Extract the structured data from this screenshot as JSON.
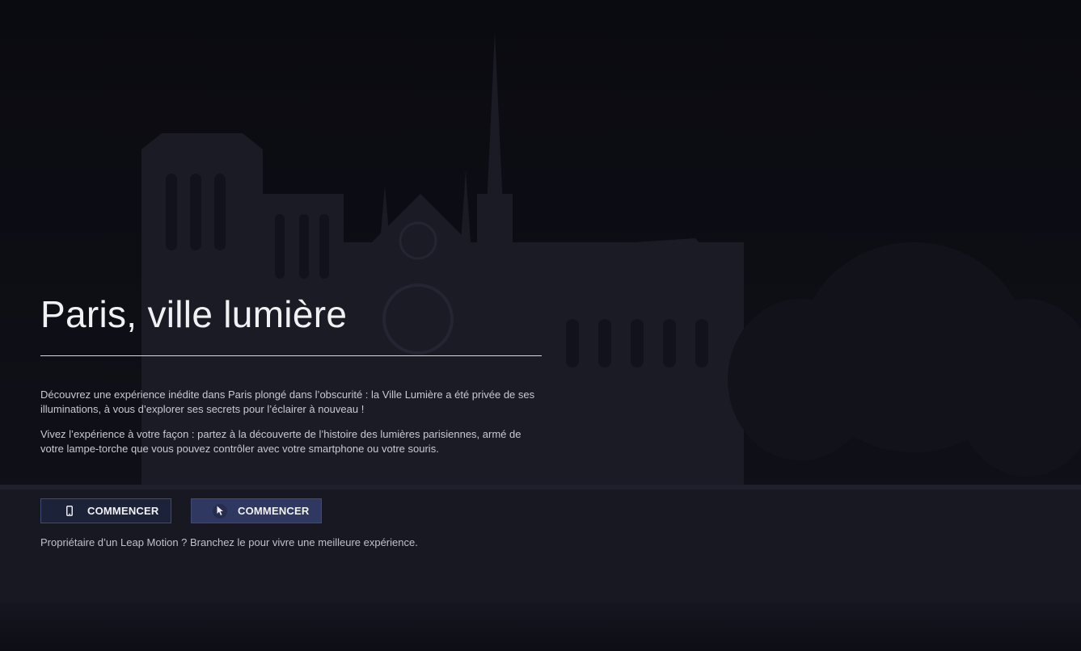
{
  "hero": {
    "title": "Paris, ville lumière",
    "paragraph_1": "Découvrez une expérience inédite dans Paris plongé dans l’obscurité : la Ville Lumière a été privée de ses illuminations, à vous d’explorer ses secrets pour l’éclairer à nouveau !",
    "paragraph_2": "Vivez l’expérience à votre façon : partez à la découverte de l’histoire des lumières parisiennes, armé de votre lampe-torche que vous pouvez contrôler avec votre smartphone ou votre souris.",
    "footnote": "Propriétaire d’un Leap Motion ? Branchez le pour vivre une meilleure expérience."
  },
  "buttons": {
    "smartphone": {
      "label": "COMMENCER",
      "icon": "smartphone-icon"
    },
    "mouse": {
      "label": "COMMENCER",
      "icon": "mouse-cursor-icon"
    }
  },
  "colors": {
    "background": "#0c0c13",
    "button_dark": "#1c2238",
    "button_accent": "#2f3860",
    "button_border": "#3f4a78",
    "text": "#f1f1f4"
  }
}
